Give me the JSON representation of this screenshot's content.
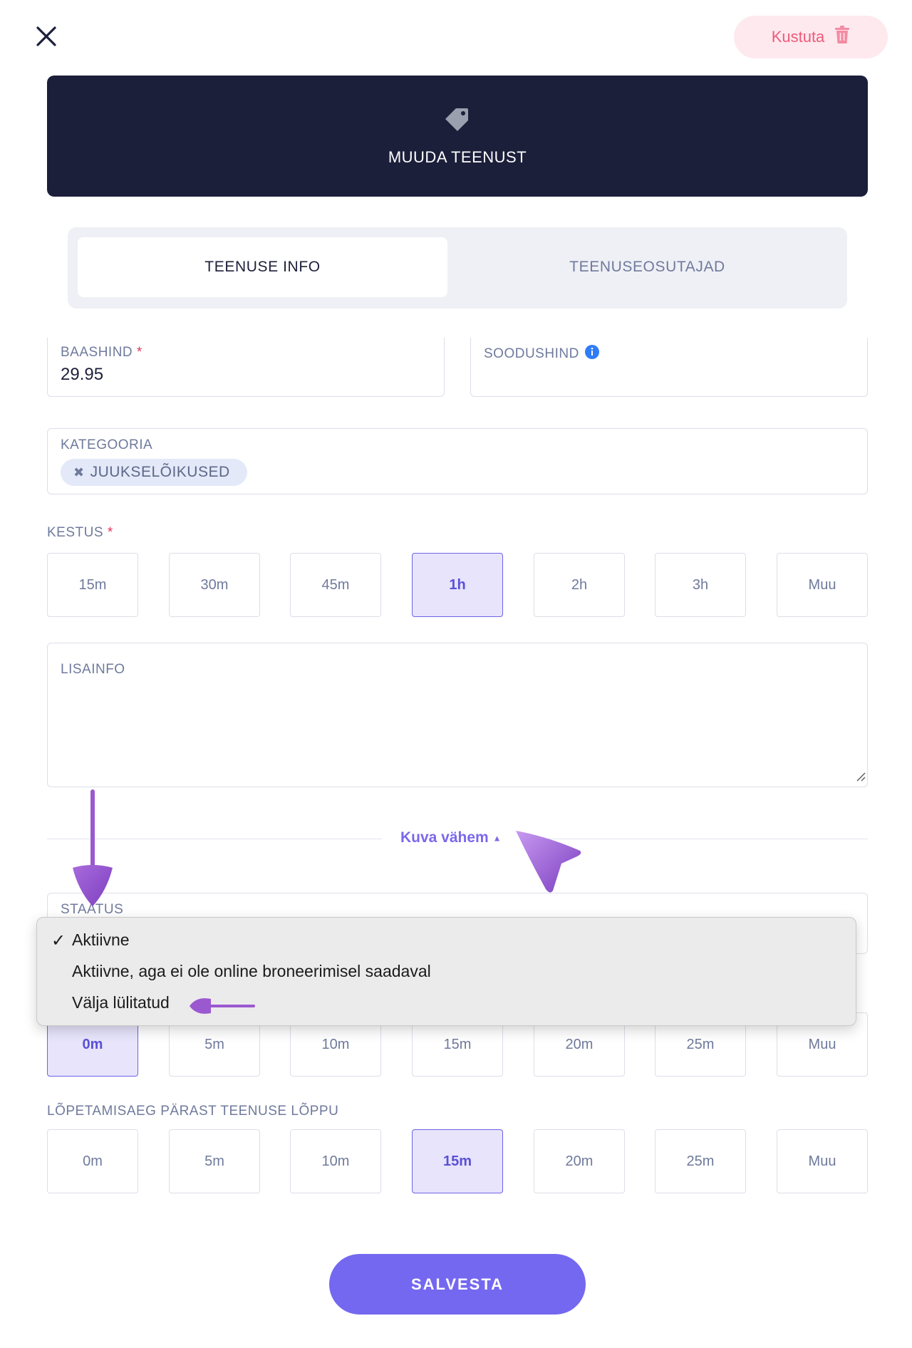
{
  "header": {
    "delete_label": "Kustuta",
    "title": "MUUDA TEENUST"
  },
  "tabs": [
    {
      "label": "TEENUSE INFO",
      "active": true
    },
    {
      "label": "TEENUSEOSUTAJAD",
      "active": false
    }
  ],
  "fields": {
    "base_price": {
      "label": "BAASHIND",
      "value": "29.95",
      "required": true
    },
    "discount_price": {
      "label": "SOODUSHIND",
      "value": ""
    },
    "category": {
      "label": "KATEGOORIA",
      "chip": "JUUKSELÕIKUSED"
    },
    "duration": {
      "label": "KESTUS",
      "required": true,
      "options": [
        "15m",
        "30m",
        "45m",
        "1h",
        "2h",
        "3h",
        "Muu"
      ],
      "selected": "1h"
    },
    "extra_info": {
      "label": "LISAINFO",
      "value": ""
    },
    "status": {
      "label": "STAATUS"
    },
    "prep_time": {
      "options": [
        "0m",
        "5m",
        "10m",
        "15m",
        "20m",
        "25m",
        "Muu"
      ],
      "selected": "0m"
    },
    "finish_time": {
      "label": "LÕPETAMISAEG PÄRAST TEENUSE LÕPPU",
      "options": [
        "0m",
        "5m",
        "10m",
        "15m",
        "20m",
        "25m",
        "Muu"
      ],
      "selected": "15m"
    }
  },
  "toggle": {
    "label": "Kuva vähem"
  },
  "status_dropdown": {
    "options": [
      "Aktiivne",
      "Aktiivne, aga ei ole online broneerimisel saadaval",
      "Välja lülitatud"
    ],
    "checked": "Aktiivne",
    "check_mark": "✓"
  },
  "save_label": "SALVESTA",
  "colors": {
    "navy": "#1c1f3a",
    "accent": "#7468f0",
    "selected_bg": "#e7e4fb",
    "danger": "#ef5a7a",
    "annotation": "#9b59d0"
  }
}
